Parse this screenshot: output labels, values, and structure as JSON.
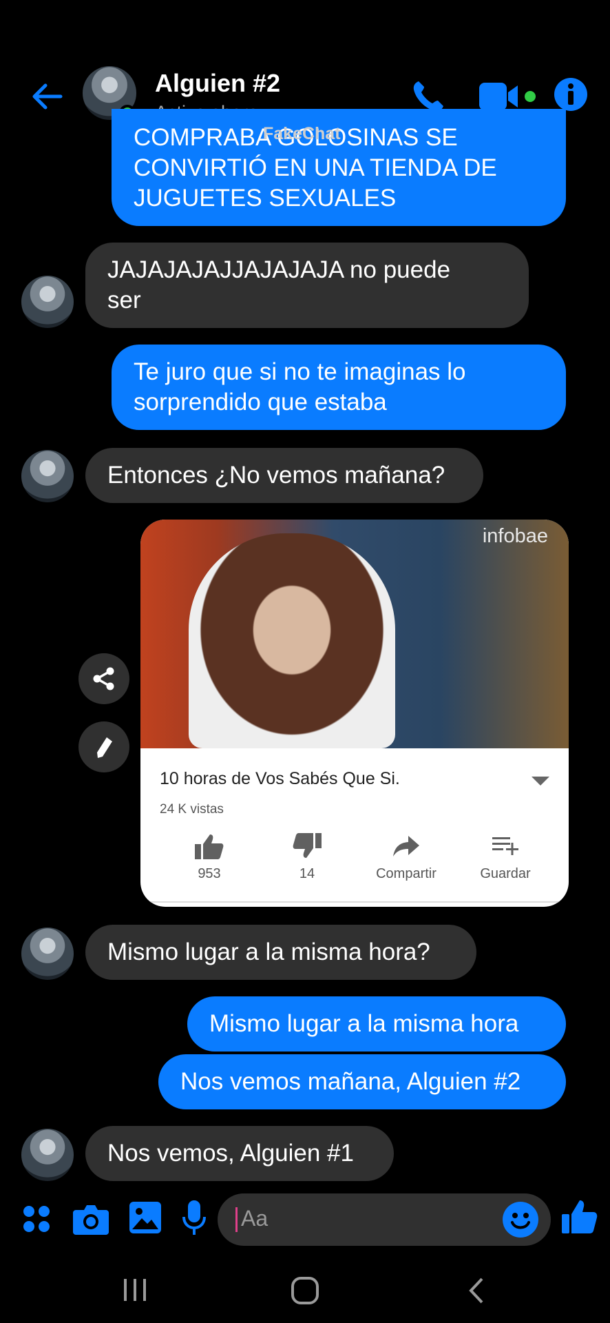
{
  "colors": {
    "accent": "#0a7cff",
    "incoming": "#303030",
    "online": "#31cc46"
  },
  "header": {
    "back_icon": "back-arrow-icon",
    "contact_name": "Alguien #2",
    "status": "Activo ahora",
    "phone_icon": "phone-icon",
    "video_icon": "video-camera-icon",
    "info_icon": "info-icon"
  },
  "watermark": "FakeChat",
  "messages": [
    {
      "from": "me",
      "text": "COMPRABA GOLOSINAS SE\nCONVIRTIÓ EN UNA TIENDA DE\nJUGUETES SEXUALES"
    },
    {
      "from": "them",
      "text": "JAJAJAJAJJAJAJAJA no puede\nser"
    },
    {
      "from": "me",
      "text": "Te juro que si no te imaginas lo\nsorprendido que estaba"
    },
    {
      "from": "them",
      "text": "Entonces ¿No vemos mañana?"
    },
    {
      "from": "me",
      "text": "Mismo lugar a la misma hora"
    },
    {
      "from": "me",
      "text": "Nos vemos mañana, Alguien #2"
    },
    {
      "from": "them",
      "text": "Mismo lugar a la misma hora?"
    },
    {
      "from": "them",
      "text": "Nos vemos, Alguien #1"
    }
  ],
  "video_card": {
    "channel_logo": "infobae",
    "title": "10 horas de Vos Sabés Que Si.",
    "views": "24 K vistas",
    "likes": "953",
    "dislikes": "14",
    "share_label": "Compartir",
    "save_label": "Guardar"
  },
  "composer": {
    "placeholder": "Aa",
    "icons": [
      "apps-icon",
      "camera-icon",
      "gallery-icon",
      "microphone-icon",
      "emoji-icon",
      "thumbs-up-icon"
    ]
  },
  "navbar": {
    "icons": [
      "recent-apps-icon",
      "home-icon",
      "back-icon"
    ]
  }
}
